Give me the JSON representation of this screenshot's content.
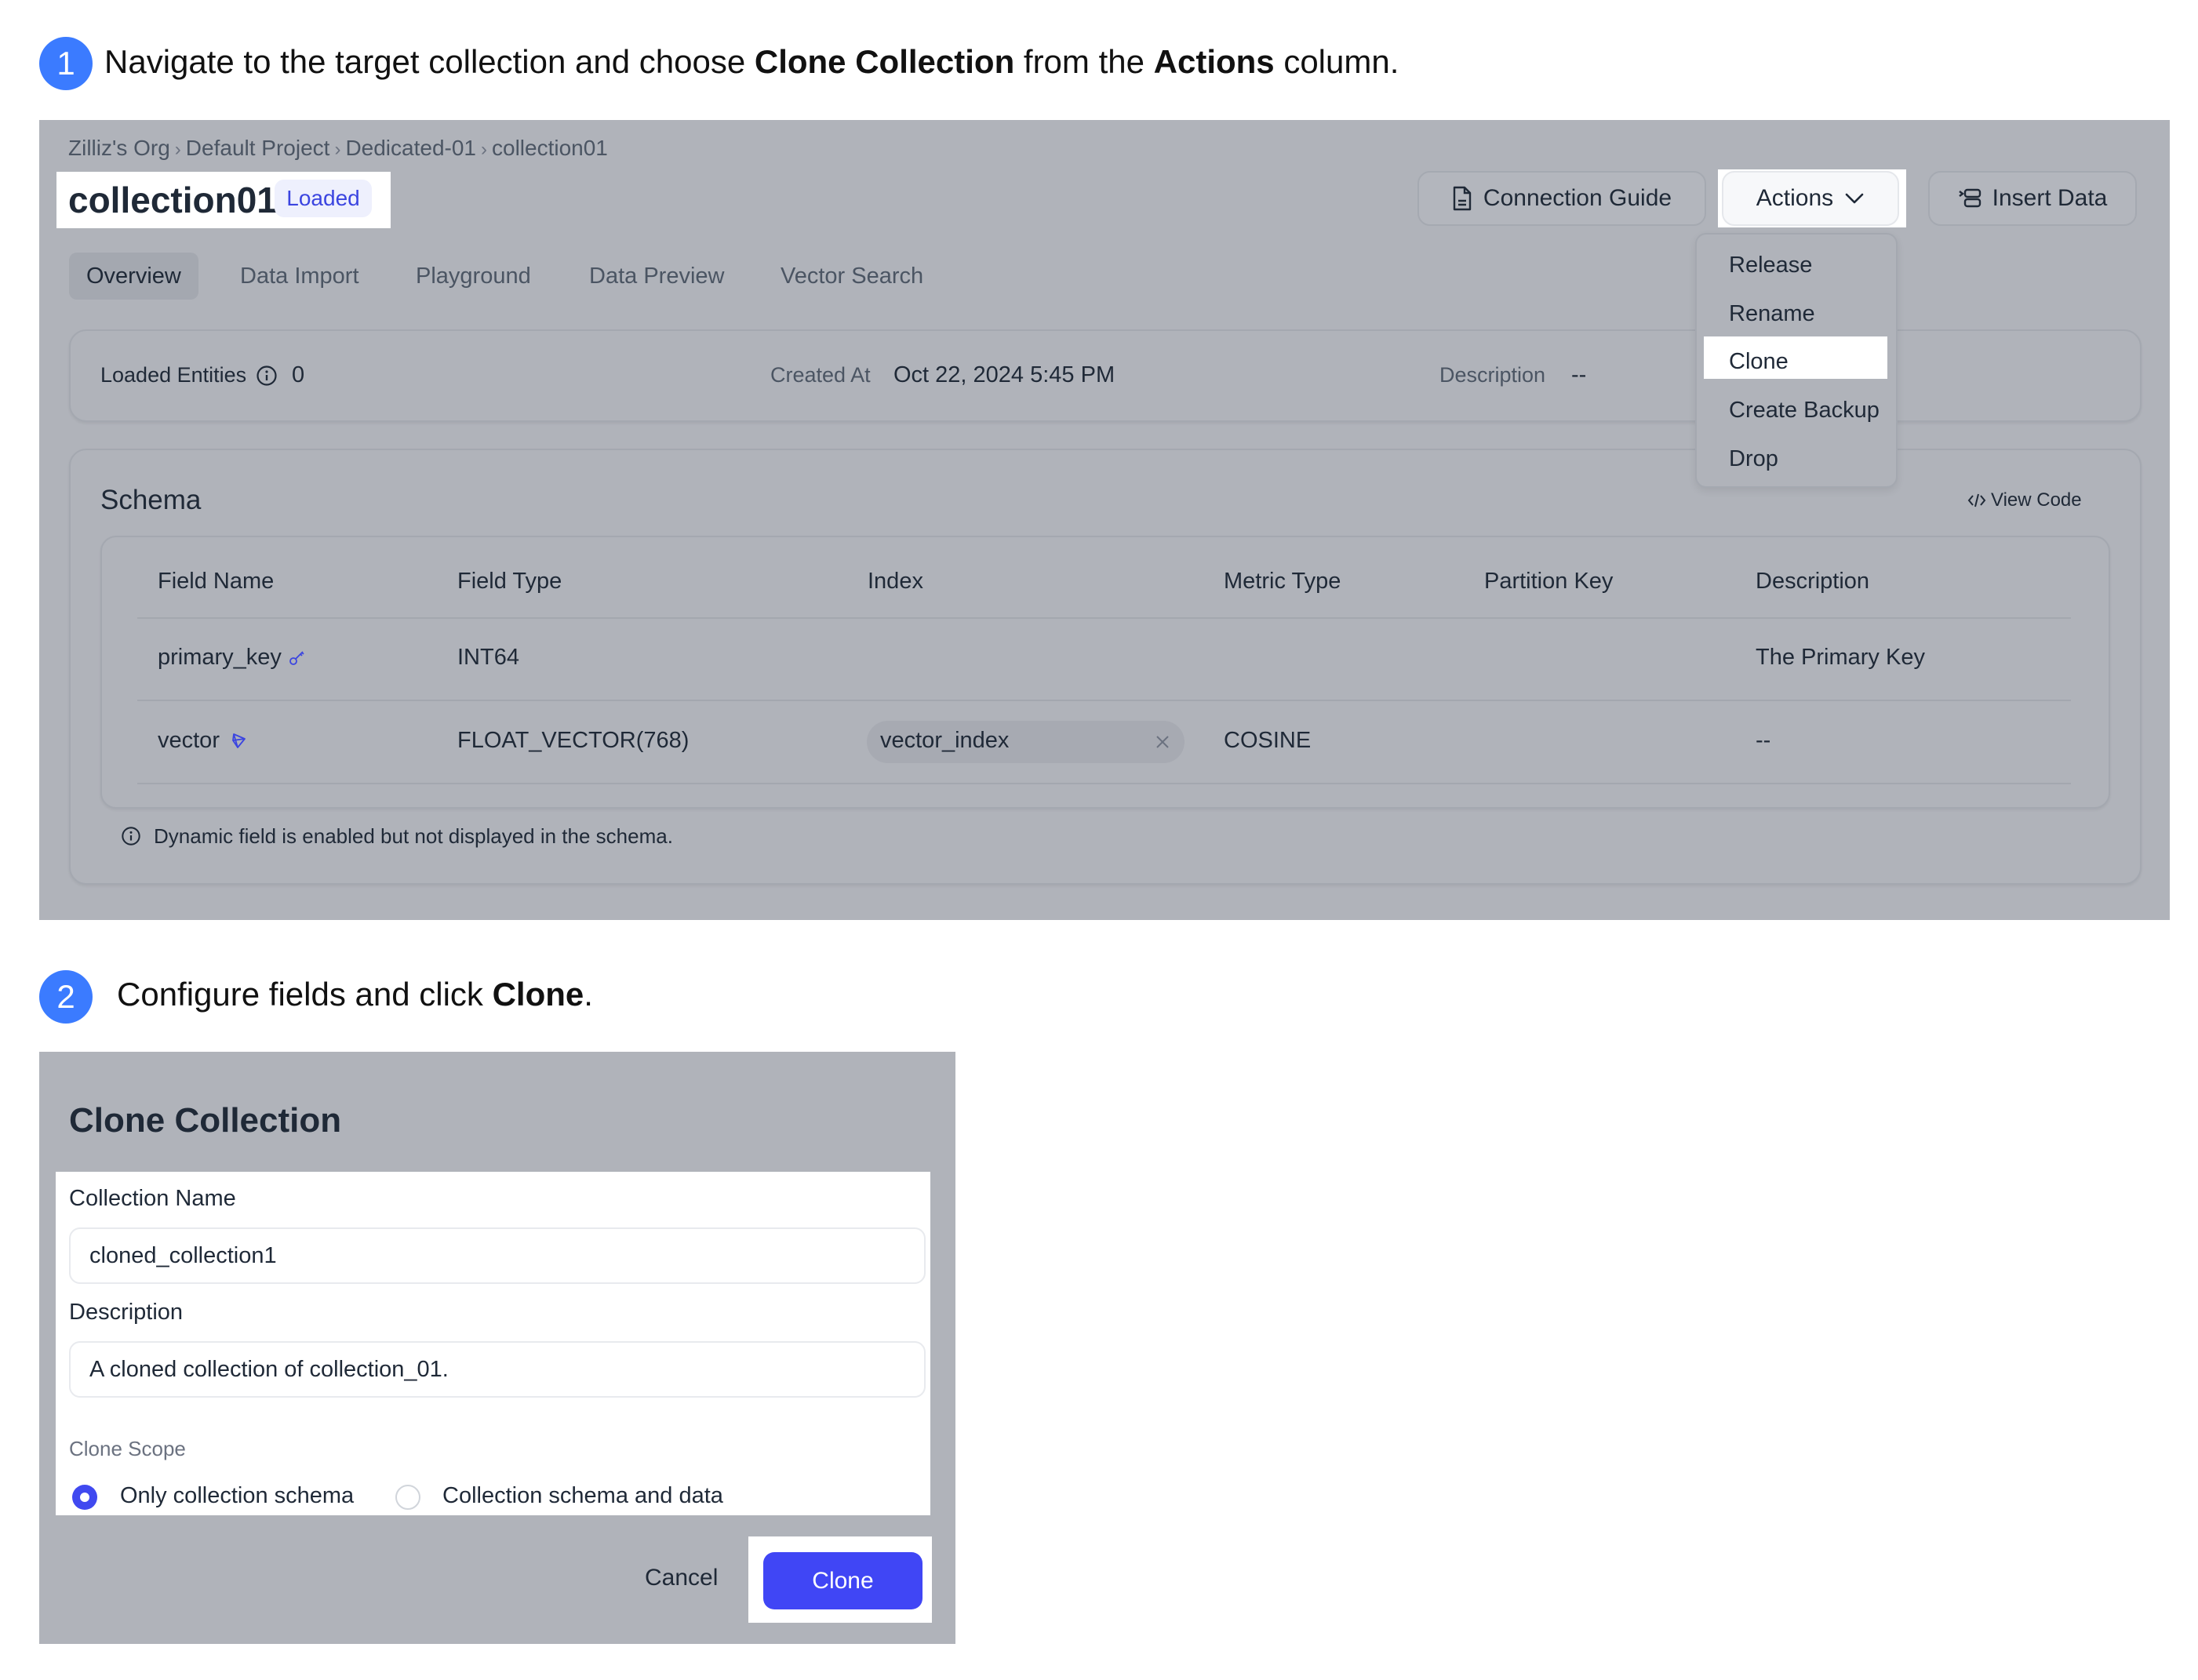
{
  "steps": [
    {
      "number": "1",
      "text_parts": [
        {
          "text": "Navigate to the target collection and choose ",
          "bold": false
        },
        {
          "text": "Clone Collection",
          "bold": true
        },
        {
          "text": " from the ",
          "bold": false
        },
        {
          "text": "Actions",
          "bold": true
        },
        {
          "text": " column.",
          "bold": false
        }
      ]
    },
    {
      "number": "2",
      "text_parts": [
        {
          "text": "Configure fields and click ",
          "bold": false
        },
        {
          "text": "Clone",
          "bold": true
        },
        {
          "text": ".",
          "bold": false
        }
      ]
    }
  ],
  "collection_page": {
    "breadcrumb": [
      "Zilliz's Org",
      "Default Project",
      "Dedicated-01",
      "collection01"
    ],
    "breadcrumb_separator": "›",
    "title": "collection01",
    "status_badge": "Loaded",
    "buttons": {
      "connection_guide": "Connection Guide",
      "actions": "Actions",
      "insert_data": "Insert Data"
    },
    "tabs": [
      {
        "label": "Overview",
        "active": true
      },
      {
        "label": "Data Import",
        "active": false
      },
      {
        "label": "Playground",
        "active": false
      },
      {
        "label": "Data Preview",
        "active": false
      },
      {
        "label": "Vector Search",
        "active": false
      }
    ],
    "info": {
      "loaded_entities_label": "Loaded Entities",
      "loaded_entities_value": "0",
      "created_at_label": "Created At",
      "created_at_value": "Oct 22, 2024 5:45 PM",
      "description_label": "Description",
      "description_value": "--"
    },
    "actions_menu": {
      "items": [
        "Release",
        "Rename",
        "Clone",
        "Create Backup",
        "Drop"
      ],
      "highlighted": "Clone"
    },
    "schema": {
      "title": "Schema",
      "view_code": "View Code",
      "columns": [
        "Field Name",
        "Field Type",
        "Index",
        "Metric Type",
        "Partition Key",
        "Description"
      ],
      "rows": [
        {
          "field_name": "primary_key",
          "icon": "key-icon",
          "field_type": "INT64",
          "index": "",
          "metric_type": "",
          "partition_key": "",
          "description": "The Primary Key"
        },
        {
          "field_name": "vector",
          "icon": "vector-icon",
          "field_type": "FLOAT_VECTOR(768)",
          "index": "vector_index",
          "metric_type": "COSINE",
          "partition_key": "",
          "description": "--"
        }
      ],
      "note": "Dynamic field is enabled but not displayed in the schema."
    }
  },
  "clone_dialog": {
    "title": "Clone Collection",
    "collection_name_label": "Collection Name",
    "collection_name_value": "cloned_collection1",
    "description_label": "Description",
    "description_value": "A cloned collection of collection_01.",
    "clone_scope_label": "Clone Scope",
    "scope_options": [
      {
        "label": "Only collection schema",
        "selected": true
      },
      {
        "label": "Collection schema and data",
        "selected": false
      }
    ],
    "cancel_label": "Cancel",
    "clone_label": "Clone"
  },
  "colors": {
    "step_badge": "#3b7bff",
    "overlay_gray": "#b0b3ba",
    "primary_button": "#4046f5",
    "loaded_badge_text": "#3b45e0",
    "field_icon": "#3b45e0"
  }
}
